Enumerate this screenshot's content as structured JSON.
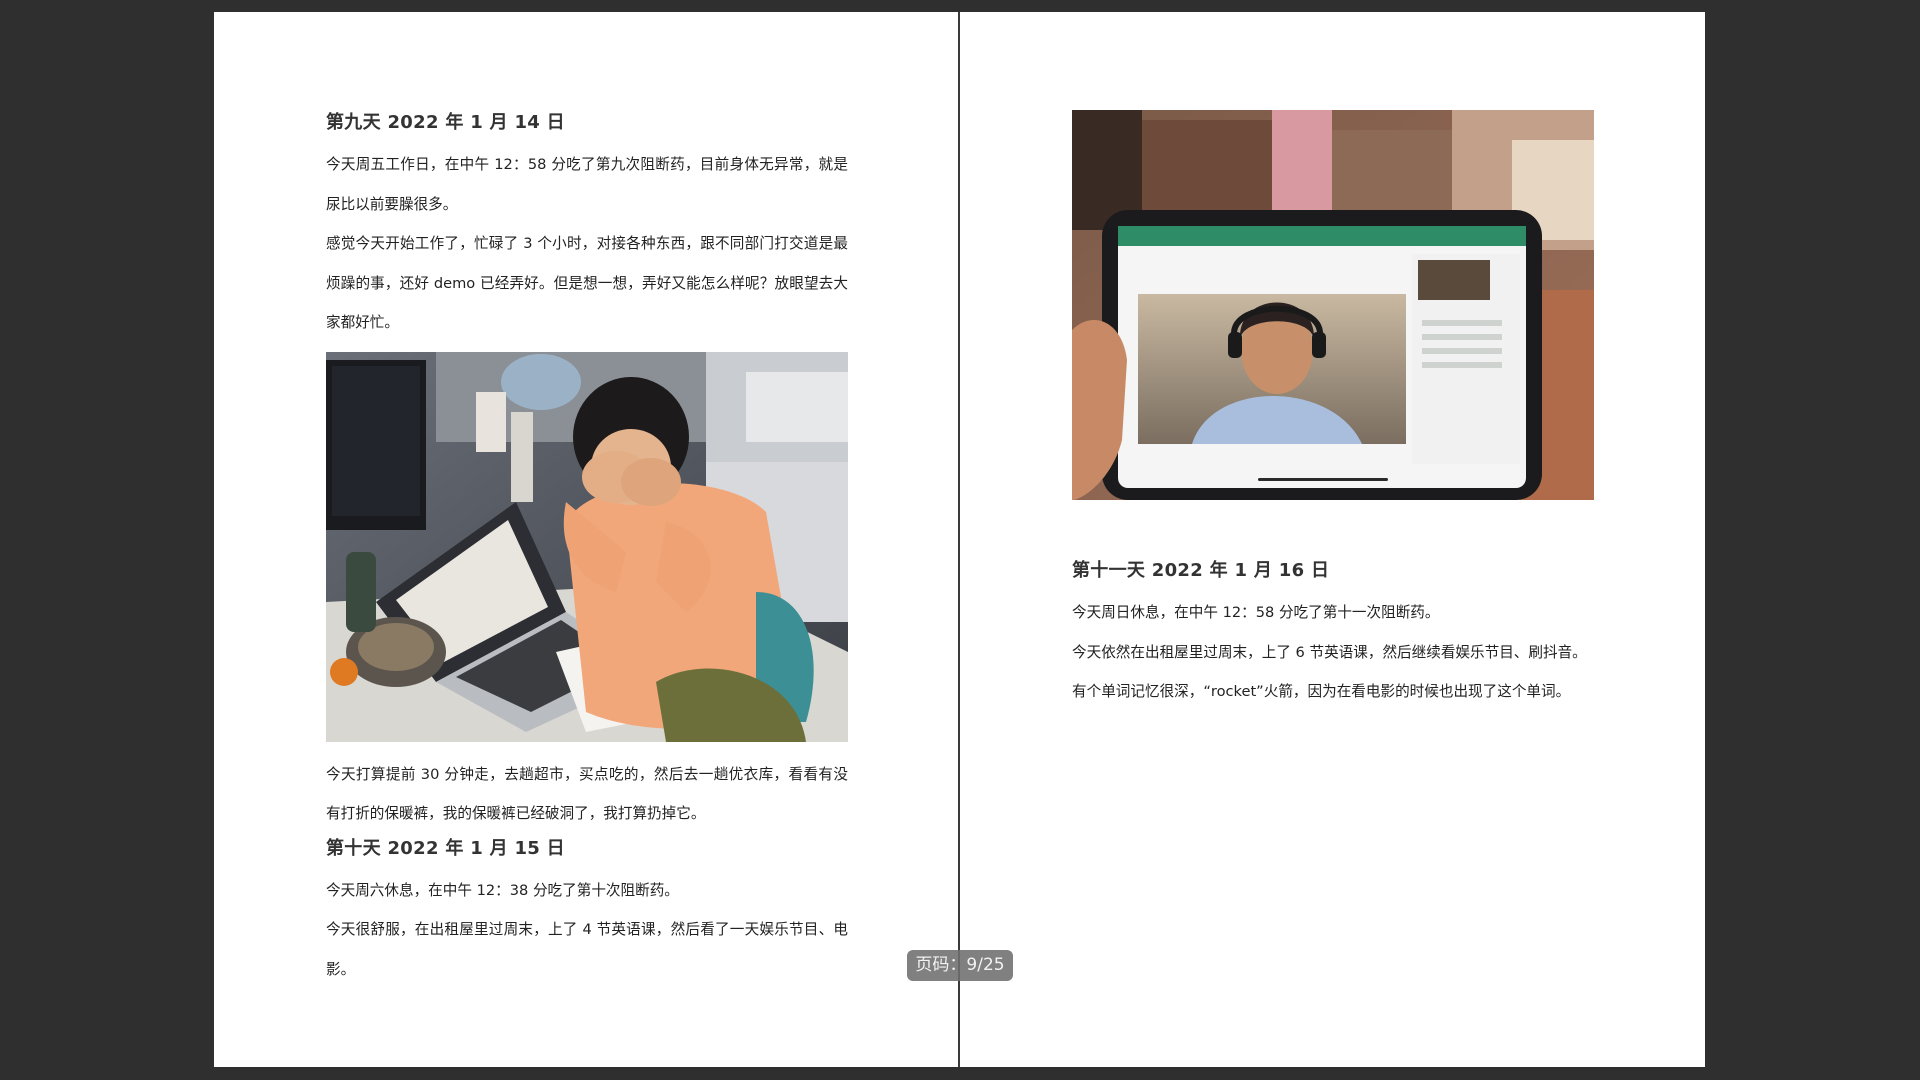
{
  "viewer": {
    "page_indicator_label": "页码：",
    "page_indicator_value": "9/25"
  },
  "left_page": {
    "day9": {
      "heading": "第九天  2022 年 1 月 14 日",
      "paragraphs": [
        "今天周五工作日，在中午 12：58 分吃了第九次阻断药，目前身体无异常，就是尿比以前要臊很多。",
        "感觉今天开始工作了，忙碌了 3 个小时，对接各种东西，跟不同部门打交道是最烦躁的事，还好 demo 已经弄好。但是想一想，弄好又能怎么样呢？放眼望去大家都好忙。"
      ],
      "photo_description": "office-desk-photo",
      "after_photo": "今天打算提前 30 分钟走，去趟超市，买点吃的，然后去一趟优衣库，看看有没有打折的保暖裤，我的保暖裤已经破洞了，我打算扔掉它。"
    },
    "day10": {
      "heading": "第十天  2022 年 1 月 15 日",
      "paragraphs": [
        "今天周六休息，在中午 12：38 分吃了第十次阻断药。",
        "今天很舒服，在出租屋里过周末，上了 4 节英语课，然后看了一天娱乐节目、电影。"
      ]
    }
  },
  "right_page": {
    "photo_description": "tablet-video-call-photo",
    "day11": {
      "heading": "第十一天  2022 年 1 月 16 日",
      "paragraphs": [
        "今天周日休息，在中午 12：58 分吃了第十一次阻断药。",
        "今天依然在出租屋里过周末，上了 6 节英语课，然后继续看娱乐节目、刷抖音。",
        "有个单词记忆很深，“rocket”火箭，因为在看电影的时候也出现了这个单词。"
      ]
    }
  },
  "colors": {
    "background": "#2f2f2f",
    "page": "#ffffff",
    "text": "#222222"
  }
}
